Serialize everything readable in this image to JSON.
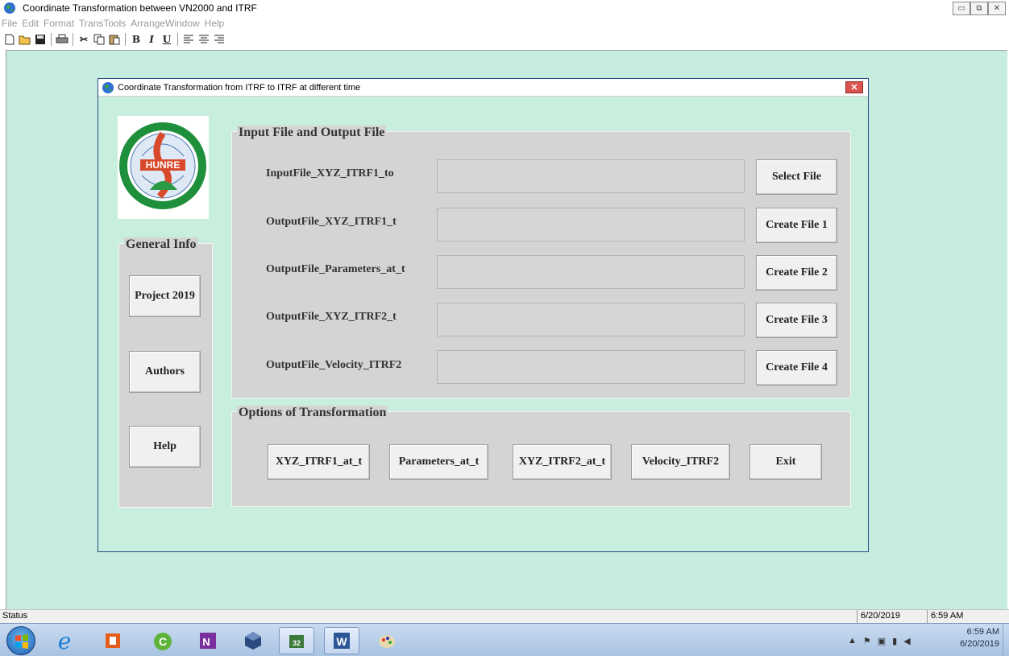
{
  "window": {
    "title": "Coordinate Transformation between VN2000 and ITRF",
    "icon": "globe-icon"
  },
  "menu": [
    "File",
    "Edit",
    "Format",
    "TransTools",
    "ArrangeWindow",
    "Help"
  ],
  "toolbar": {
    "icons": [
      "new-file-icon",
      "open-folder-icon",
      "save-icon",
      "print-icon",
      "cut-icon",
      "copy-icon",
      "paste-icon",
      "bold-icon",
      "italic-icon",
      "underline-icon",
      "align-left-icon",
      "align-center-icon",
      "align-right-icon"
    ],
    "bold": "B",
    "italic": "I",
    "underline": "U"
  },
  "dialog": {
    "title": "Coordinate Transformation from ITRF to ITRF at different time",
    "logo_text": "HUNRE",
    "general_info": {
      "legend": "General Info",
      "buttons": [
        "Project 2019",
        "Authors",
        "Help"
      ]
    },
    "files": {
      "legend": "Input File and Output File",
      "rows": [
        {
          "label": "InputFile_XYZ_ITRF1_to",
          "value": "",
          "button": "Select File"
        },
        {
          "label": "OutputFile_XYZ_ITRF1_t",
          "value": "",
          "button": "Create File 1"
        },
        {
          "label": "OutputFile_Parameters_at_t",
          "value": "",
          "button": "Create File 2"
        },
        {
          "label": "OutputFile_XYZ_ITRF2_t",
          "value": "",
          "button": "Create File 3"
        },
        {
          "label": "OutputFile_Velocity_ITRF2",
          "value": "",
          "button": "Create File 4"
        }
      ]
    },
    "options": {
      "legend": "Options of Transformation",
      "buttons": [
        "XYZ_ITRF1_at_t",
        "Parameters_at_t",
        "XYZ_ITRF2_at_t",
        "Velocity_ITRF2",
        "Exit"
      ]
    }
  },
  "status": {
    "text": "Status",
    "date": "6/20/2019",
    "time": "6:59 AM"
  },
  "taskbar": {
    "apps": [
      "internet-explorer-icon",
      "office-icon",
      "coreldraw-icon",
      "onenote-icon",
      "virtualbox-icon",
      "app-32-icon",
      "word-icon",
      "paint-icon"
    ],
    "clock_time": "6:59 AM",
    "clock_date": "6/20/2019"
  },
  "colors": {
    "mdi_background": "#c5ecdc",
    "panel": "#d4d4d4",
    "button": "#f0f0f0",
    "close_red": "#d9534f"
  }
}
